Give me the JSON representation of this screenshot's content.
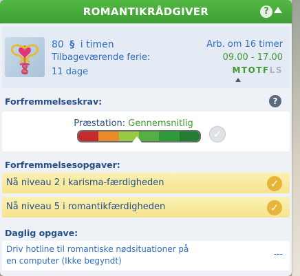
{
  "header": {
    "title": "ROMANTIKRÅDGIVER",
    "help_glyph": "?"
  },
  "career": {
    "pay_amount": "80",
    "currency_symbol": "§",
    "pay_unit": "i timen",
    "vacation_label": "Tilbageværende ferie:",
    "vacation_days": "11 dage",
    "work_label": "Arb. om 16 timer",
    "hours": "09.00 - 17.00",
    "weekdays": [
      {
        "letter": "M",
        "working": true
      },
      {
        "letter": "T",
        "working": true
      },
      {
        "letter": "O",
        "working": true
      },
      {
        "letter": "T",
        "working": true
      },
      {
        "letter": "F",
        "working": true
      },
      {
        "letter": "L",
        "working": false
      },
      {
        "letter": "S",
        "working": false
      }
    ]
  },
  "promotion_requirements": {
    "title": "Forfremmelseskrav:",
    "help_glyph": "?",
    "performance_label": "Præstation:",
    "performance_value": "Gennemsnitlig",
    "meter_segments": [
      "#c52a2e",
      "#e8892a",
      "#97c945",
      "#54b045",
      "#2f9a3a",
      "#237d33"
    ],
    "meter_level_fraction": 0.5
  },
  "promotion_tasks": {
    "title": "Forfremmelsesopgaver:",
    "items": [
      {
        "text": "Nå niveau 2 i karisma-færdigheden",
        "done": true
      },
      {
        "text": "Nå niveau 5 i romantikfærdigheden",
        "done": true
      }
    ]
  },
  "daily_task": {
    "title": "Daglig opgave:",
    "line1": "Driv hotline til romantiske nødsituationer på",
    "line2": "en computer (Ikke begyndt)",
    "progress": "---"
  },
  "colors": {
    "header_green": "#4cb03e",
    "text_blue": "#2f6ec3",
    "heading_blue": "#244f88",
    "accent_green": "#3d9b2d",
    "task_yellow": "#f6e38d",
    "check_gold": "#e7b53a"
  },
  "icons": {
    "career_icon": "heart-caduceus-icon",
    "checkmark": "✓"
  }
}
